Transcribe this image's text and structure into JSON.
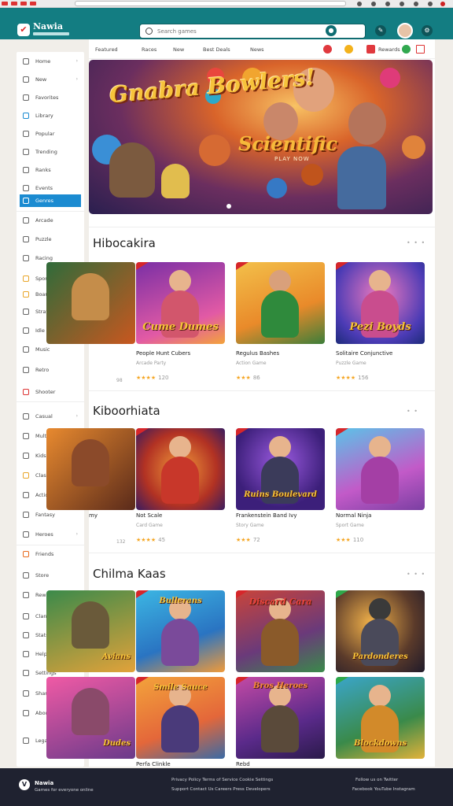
{
  "app": {
    "brand": "Nawia"
  },
  "search": {
    "placeholder": "Search games"
  },
  "sidebar": {
    "items": [
      {
        "label": "Home",
        "chev": "›"
      },
      {
        "label": "New",
        "chev": "›"
      },
      {
        "label": "Favorites",
        "chev": ""
      },
      {
        "label": "Library",
        "chev": ""
      },
      {
        "label": "Popular",
        "chev": ""
      },
      {
        "label": "Trending",
        "chev": ""
      },
      {
        "label": "Ranks",
        "chev": ""
      },
      {
        "label": "Events",
        "chev": ""
      },
      {
        "label": "Genres",
        "chev": ""
      },
      {
        "label": "Arcade",
        "chev": ""
      },
      {
        "label": "Puzzle",
        "chev": ""
      },
      {
        "label": "Racing",
        "chev": ""
      },
      {
        "label": "Sports",
        "chev": ""
      },
      {
        "label": "Board",
        "chev": ""
      },
      {
        "label": "Strategy",
        "chev": ""
      },
      {
        "label": "Idle",
        "chev": ""
      },
      {
        "label": "Music",
        "chev": ""
      },
      {
        "label": "Retro",
        "chev": ""
      },
      {
        "label": "Shooter",
        "chev": ""
      },
      {
        "label": "Casual",
        "chev": "›"
      },
      {
        "label": "Multi",
        "chev": ""
      },
      {
        "label": "Kids",
        "chev": ""
      },
      {
        "label": "Classic",
        "chev": ""
      },
      {
        "label": "Action",
        "chev": ""
      },
      {
        "label": "Fantasy",
        "chev": ""
      },
      {
        "label": "Heroes",
        "chev": "›"
      },
      {
        "label": "Friends",
        "chev": ""
      },
      {
        "label": "Store",
        "chev": ""
      },
      {
        "label": "Rewards",
        "chev": ""
      },
      {
        "label": "Clans",
        "chev": ""
      },
      {
        "label": "Stats",
        "chev": ""
      },
      {
        "label": "Help",
        "chev": ""
      },
      {
        "label": "Settings",
        "chev": ""
      },
      {
        "label": "Share",
        "chev": ""
      },
      {
        "label": "About",
        "chev": ""
      },
      {
        "label": "Legal",
        "chev": ""
      }
    ]
  },
  "subnav": {
    "items": [
      "Featured",
      "Races",
      "New",
      "Best Deals",
      "News"
    ],
    "right_label": "Rewards"
  },
  "hero": {
    "title": "Gnabra Bowlers!",
    "subtitle": "Scientific",
    "tagline": "PLAY NOW"
  },
  "sections": [
    {
      "title": "Hibocakira",
      "more": "• • •",
      "cards": [
        {
          "art": "",
          "title": "",
          "sub": "",
          "stars": "",
          "count": "98"
        },
        {
          "art": "Cume Dumes",
          "title": "People Hunt Cubers",
          "sub": "Arcade Party",
          "stars": "★★★★",
          "count": "120"
        },
        {
          "art": "",
          "title": "Regulus Bashes",
          "sub": "Action Game",
          "stars": "★★★",
          "count": "86"
        },
        {
          "art": "Pezi Boyds",
          "title": "Solitaire Conjunctive",
          "sub": "Puzzle Game",
          "stars": "★★★★",
          "count": "156"
        }
      ]
    },
    {
      "title": "Kiboorhiata",
      "more": "• •",
      "cards": [
        {
          "art": "",
          "title": "my",
          "sub": "",
          "stars": "",
          "count": "132"
        },
        {
          "art": "",
          "title": "Not Scale",
          "sub": "Card Game",
          "stars": "★★★★",
          "count": "45"
        },
        {
          "art": "Ruins Boulevard",
          "title": "Frankenstein Band Ivy",
          "sub": "Story Game",
          "stars": "★★★",
          "count": "72"
        },
        {
          "art": "",
          "title": "Normal Ninja",
          "sub": "Sport Game",
          "stars": "★★★",
          "count": "110"
        }
      ]
    },
    {
      "title": "Chilma Kaas",
      "more": "• • •",
      "cards": [
        {
          "art": "Avians",
          "title": "",
          "sub": "",
          "stars": "",
          "count": ""
        },
        {
          "art": "Bullerans",
          "title": "",
          "sub": "",
          "stars": "",
          "count": ""
        },
        {
          "art": "Discard Cara",
          "title": "",
          "sub": "",
          "stars": "",
          "count": ""
        },
        {
          "art": "Pardonderes",
          "title": "",
          "sub": "",
          "stars": "",
          "count": ""
        },
        {
          "art": "Dudes",
          "title": "",
          "sub": "",
          "stars": "",
          "count": ""
        },
        {
          "art": "Smile Sauce",
          "title": "",
          "sub": "",
          "stars": "",
          "count": ""
        },
        {
          "art": "Bros Heroes",
          "title": "",
          "sub": "",
          "stars": "",
          "count": ""
        },
        {
          "art": "Blockdowns",
          "title": "",
          "sub": "",
          "stars": "",
          "count": ""
        }
      ],
      "below_label": "Perfa Clinkle",
      "below_label2": "Rebd"
    }
  ],
  "footer": {
    "brand": "Nawia",
    "tagline": "Games for everyone online",
    "mid1": "Privacy Policy  Terms of Service  Cookie Settings",
    "mid2": "Support  Contact Us  Careers  Press  Developers",
    "right1": "Follow us on Twitter",
    "right2": "Facebook  YouTube  Instagram"
  },
  "colors": {
    "topbar": "#137d82",
    "accent": "#1b8bd1",
    "star": "#f5a623",
    "footer": "#1f2230"
  }
}
